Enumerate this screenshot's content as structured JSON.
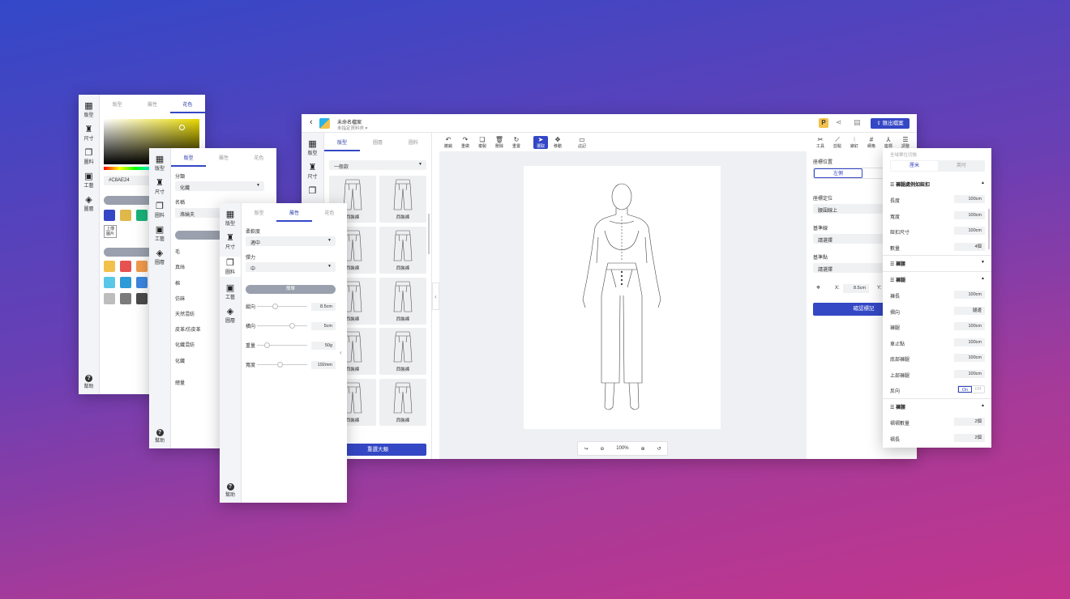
{
  "rail_items": [
    "版型",
    "尺寸",
    "圖料",
    "工藝",
    "圖層"
  ],
  "help_label": "幫助",
  "panel1": {
    "tabs": [
      "版型",
      "屬性",
      "花色"
    ],
    "hex": "#C8AE24",
    "upload_label": "上傳\n圖片",
    "section1": "色",
    "section2": "推薦"
  },
  "panel2": {
    "tabs": [
      "版型",
      "屬性",
      "花色"
    ],
    "cat_label": "分類",
    "cat_value": "化纖",
    "name_label": "名稱",
    "name_value": "滌綸夫",
    "pill": "內容",
    "materials": [
      "毛",
      "真絲",
      "棉",
      "仿麻",
      "天然混紡",
      "皮革/仿皮革",
      "化纖混紡",
      "化纖"
    ],
    "bottom": "總量"
  },
  "panel3": {
    "tabs": [
      "版型",
      "屬性",
      "花色"
    ],
    "f1_label": "柔軟度",
    "f1_value": "適中",
    "f2_label": "彈力",
    "f2_value": "中",
    "pill": "簡單",
    "sliders": [
      {
        "label": "縱向",
        "value": "8.5cm",
        "pos": 0.35
      },
      {
        "label": "橫向",
        "value": "5cm",
        "pos": 0.7
      },
      {
        "label": "重量",
        "value": "50g",
        "pos": 0.2
      },
      {
        "label": "寬度",
        "value": "192mm",
        "pos": 0.45
      }
    ]
  },
  "main": {
    "file_title": "未命名檔案",
    "file_sub": "未指定資料夾",
    "export_label": "匯出檔案",
    "left_tabs": [
      "版型",
      "圖層",
      "圖料"
    ],
    "category": "一般款",
    "pants_name": "西裝褲",
    "big_btn": "重選大類",
    "toolbar_left": [
      "撤銷",
      "重做",
      "複製",
      "刪除",
      "重置"
    ],
    "toolbar_mid": [
      "選取",
      "移動"
    ],
    "toolbar_note": "註記",
    "toolbar_right": [
      "工具",
      "剪點",
      "鉚釘",
      "網格",
      "座標",
      "調整"
    ],
    "zoom": "100%",
    "pos_title": "座標位置",
    "pos_tab": "左側",
    "coord_label": "座標定位",
    "coord_value": "腰圍線上",
    "baseline_label": "基準線",
    "baseline_value": "請選擇",
    "basepoint_label": "基準點",
    "basepoint_value": "請選擇",
    "x_label": "X:",
    "x_value": "8.5cm",
    "y_label": "Y:",
    "confirm": "確認標記"
  },
  "right": {
    "top_label": "全域單位切換",
    "unit_tabs": [
      "厘米",
      "英吋"
    ],
    "sec1": "褲腿處例如鈕扣",
    "sec1_rows": [
      [
        "長度",
        "100cm"
      ],
      [
        "寬度",
        "100cm"
      ],
      [
        "鈕扣尺寸",
        "100cm"
      ],
      [
        "數量",
        "4個"
      ]
    ],
    "sec2": "褲腰",
    "sec3": "褲腿",
    "sec3_rows": [
      [
        "褲長",
        "100cm"
      ],
      [
        "摺向",
        "腿邊"
      ],
      [
        "褲腿",
        "100cm"
      ],
      [
        "車止點",
        "100cm"
      ],
      [
        "底部褲腿",
        "100cm"
      ],
      [
        "上部褲腿",
        "100cm"
      ]
    ],
    "toggle_label": "反向",
    "on": "On",
    "off": "Off",
    "sec4": "褲腰",
    "sec4_rows": [
      [
        "褶褶數量",
        "2個"
      ],
      [
        "褶長",
        "2個"
      ]
    ]
  }
}
